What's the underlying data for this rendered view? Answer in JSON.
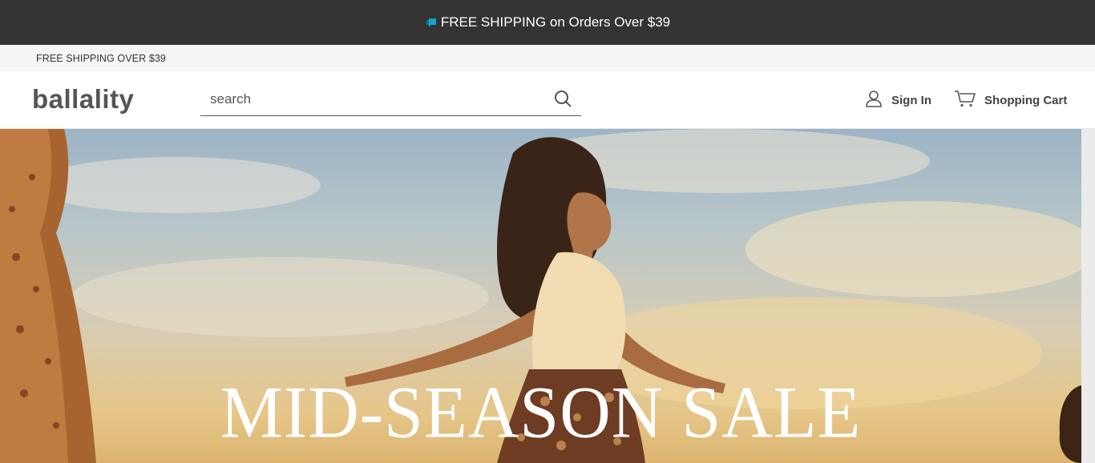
{
  "announcement": {
    "text": "FREE SHIPPING on Orders Over $39",
    "flag_icon": "flag-icon",
    "accent": "#1aa3c9"
  },
  "subbar": {
    "text": "FREE SHIPPING OVER $39"
  },
  "header": {
    "logo": "ballality",
    "search": {
      "placeholder": "search",
      "value": "",
      "icon": "search-icon"
    },
    "sign_in": {
      "label": "Sign In",
      "icon": "user-icon"
    },
    "cart": {
      "label": "Shopping Cart",
      "icon": "cart-icon"
    }
  },
  "hero": {
    "headline": "MID-SEASON SALE"
  },
  "colors": {
    "announce_bg": "#333333",
    "subbar_bg": "#f5f5f5",
    "text_dark": "#444444"
  }
}
